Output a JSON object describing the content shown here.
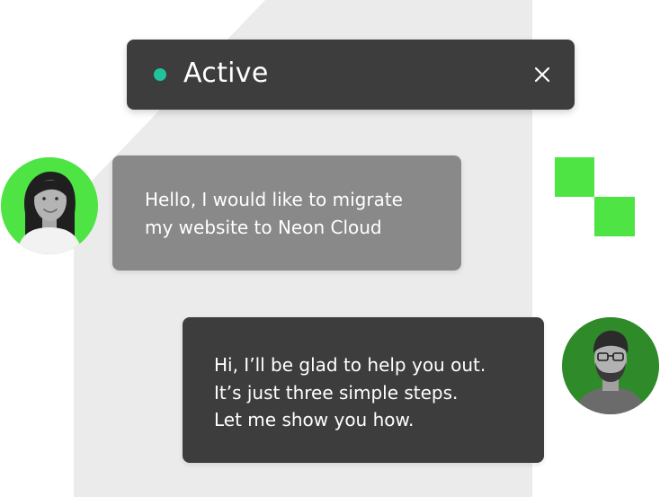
{
  "colors": {
    "accent_green": "#4ee443",
    "status_dot": "#22c29a",
    "dark_panel": "#3d3d3d",
    "user_bubble": "#898989",
    "background_shape": "#ebebeb"
  },
  "status": {
    "label": "Active",
    "dot_icon": "status-dot-icon",
    "close_icon": "close-x-icon"
  },
  "messages": [
    {
      "sender": "customer",
      "lines": [
        "Hello, I would like to migrate",
        "my website to Neon Cloud"
      ]
    },
    {
      "sender": "agent",
      "lines": [
        "Hi, I’ll be glad to help you out.",
        "It’s just three simple steps.",
        "Let me show you how."
      ]
    }
  ],
  "avatars": {
    "customer": "woman-avatar",
    "agent": "man-with-glasses-avatar"
  }
}
